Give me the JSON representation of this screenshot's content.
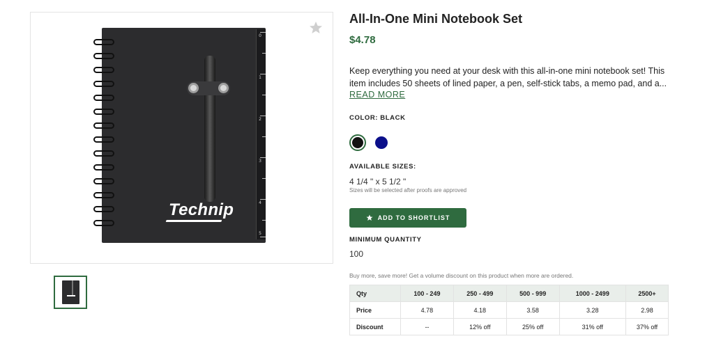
{
  "product": {
    "title": "All-In-One Mini Notebook Set",
    "price": "$4.78",
    "description": "Keep everything you need at your desk with this all-in-one mini notebook set! This item includes 50 sheets of lined paper, a pen, self-stick tabs, a memo pad, and a...",
    "read_more_label": "READ MORE",
    "image_logo_text": "Technip"
  },
  "color": {
    "label": "COLOR: BLACK",
    "options": [
      {
        "name": "Black",
        "hex": "#111111",
        "selected": true
      },
      {
        "name": "Navy",
        "hex": "#0b0f8a",
        "selected": false
      }
    ]
  },
  "sizes": {
    "label": "AVAILABLE SIZES:",
    "value": "4 1/4 \" x 5 1/2 \"",
    "note": "Sizes will be selected after proofs are approved"
  },
  "actions": {
    "shortlist_label": "ADD TO SHORTLIST"
  },
  "minimum": {
    "label": "MINIMUM QUANTITY",
    "value": "100"
  },
  "discount_note": "Buy more, save more! Get a volume discount on this product when more are ordered.",
  "pricing_table": {
    "headers": [
      "Qty",
      "100 - 249",
      "250 - 499",
      "500 - 999",
      "1000 - 2499",
      "2500+"
    ],
    "price_row": [
      "Price",
      "4.78",
      "4.18",
      "3.58",
      "3.28",
      "2.98"
    ],
    "discount_row": [
      "Discount",
      "--",
      "12% off",
      "25% off",
      "31% off",
      "37% off"
    ]
  },
  "ruler_numbers": [
    "0",
    "1",
    "2",
    "3",
    "4",
    "5"
  ],
  "colors": {
    "accent": "#2f6b3f",
    "table_header_bg": "#e9eeea"
  }
}
